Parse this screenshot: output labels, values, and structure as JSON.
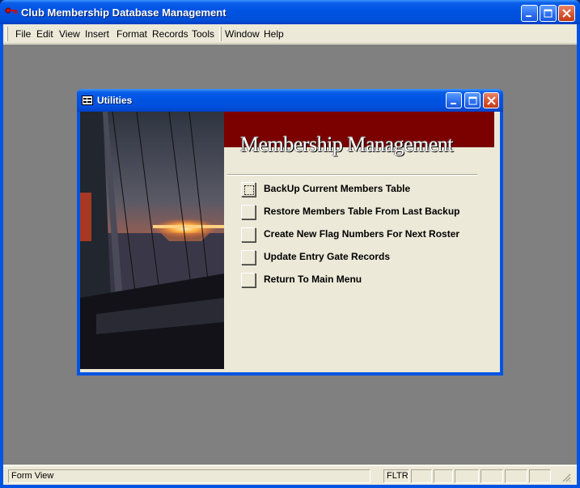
{
  "app": {
    "title": "Club Membership Database Management",
    "menu": [
      "File",
      "Edit",
      "View",
      "Insert",
      "Format",
      "Records",
      "Tools",
      "Window",
      "Help"
    ]
  },
  "child": {
    "title": "Utilities",
    "banner": "Membership Management",
    "options": [
      "BackUp Current Members Table",
      "Restore Members Table From Last Backup",
      "Create New Flag Numbers For Next Roster",
      "Update Entry Gate Records",
      "Return To Main Menu"
    ]
  },
  "status": {
    "left": "Form View",
    "filter": "FLTR"
  },
  "colors": {
    "titlebar": "#0054e3",
    "banner": "#7b0000",
    "mdi_background": "#808080",
    "face": "#ece9d8"
  }
}
